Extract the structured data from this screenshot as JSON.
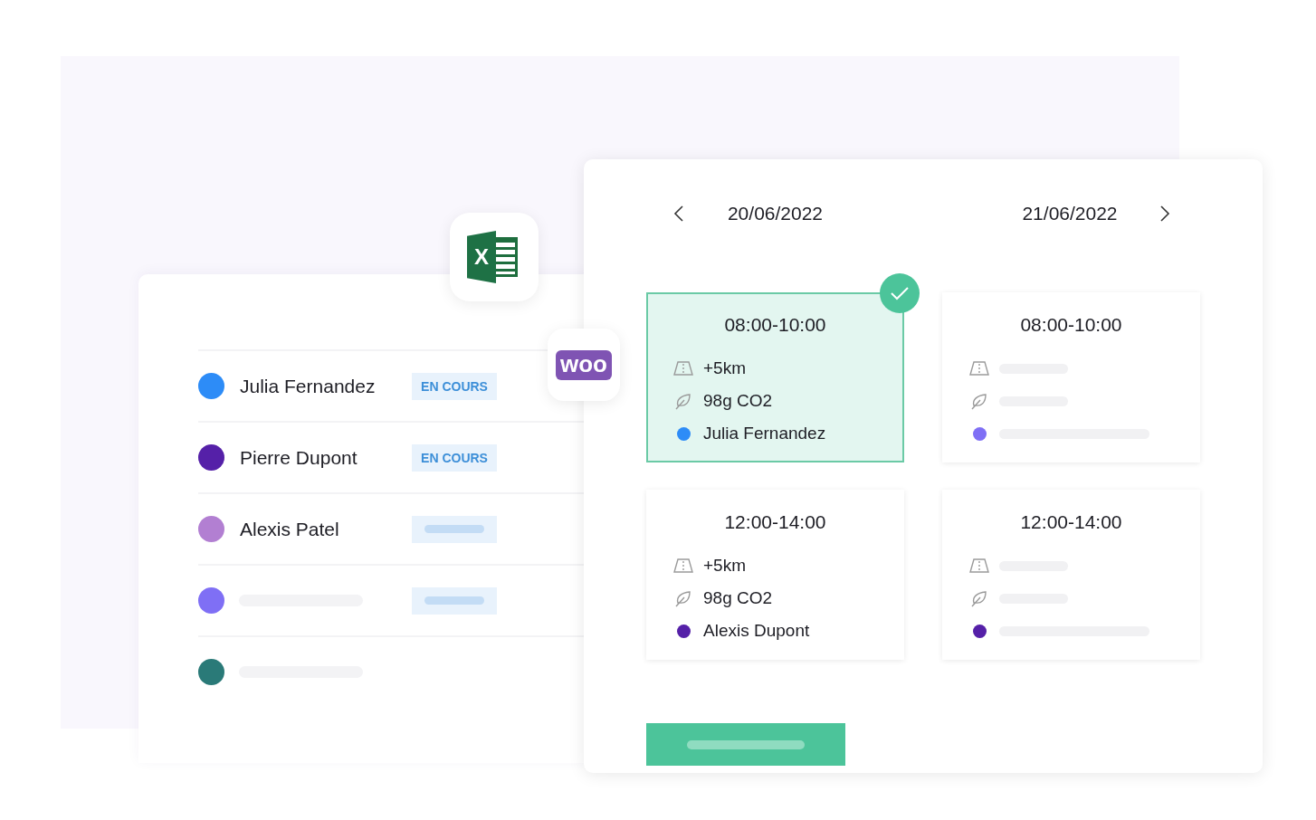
{
  "integrations": [
    {
      "kind": "excel",
      "mark": "X"
    },
    {
      "kind": "woo",
      "mark": "woo"
    }
  ],
  "people": [
    {
      "name": "Julia Fernandez",
      "color": "#2d8cf7",
      "badge": {
        "kind": "text",
        "label": "EN COURS"
      }
    },
    {
      "name": "Pierre Dupont",
      "color": "#5520a8",
      "badge": {
        "kind": "text",
        "label": "EN COURS"
      }
    },
    {
      "name": "Alexis Patel",
      "color": "#b27fd2",
      "badge": {
        "kind": "skeleton"
      }
    },
    {
      "color": "#7f6ff5",
      "badge": {
        "kind": "skeleton"
      }
    },
    {
      "color": "#2a7a78"
    }
  ],
  "planner": {
    "dates": [
      "20/06/2022",
      "21/06/2022"
    ],
    "slots": [
      {
        "time": "08:00-10:00",
        "selected": true,
        "distance": "+5km",
        "co2": "98g CO2",
        "driver": "Julia Fernandez",
        "color": "#2d8cf7"
      },
      {
        "time": "08:00-10:00",
        "selected": false,
        "color": "#7f6ff5"
      },
      {
        "time": "12:00-14:00",
        "selected": false,
        "distance": "+5km",
        "co2": "98g CO2",
        "driver": "Alexis Dupont",
        "color": "#5520a8"
      },
      {
        "time": "12:00-14:00",
        "selected": false,
        "color": "#5520a8"
      }
    ]
  }
}
